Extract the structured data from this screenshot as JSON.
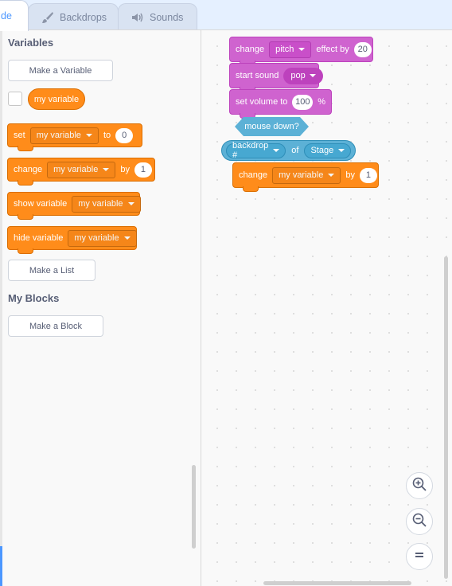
{
  "tabs": [
    {
      "label": "de",
      "icon": "code-icon"
    },
    {
      "label": "Backdrops",
      "icon": "brush-icon"
    },
    {
      "label": "Sounds",
      "icon": "speaker-icon"
    }
  ],
  "palette": {
    "variables_title": "Variables",
    "make_variable": "Make a Variable",
    "variable_reporter": "my variable",
    "set_block": {
      "label": "set",
      "var": "my variable",
      "to": "to",
      "value": "0"
    },
    "change_block": {
      "label": "change",
      "var": "my variable",
      "by": "by",
      "value": "1"
    },
    "show_block": {
      "label": "show variable",
      "var": "my variable"
    },
    "hide_block": {
      "label": "hide variable",
      "var": "my variable"
    },
    "make_list": "Make a List",
    "my_blocks_title": "My Blocks",
    "make_block": "Make a Block"
  },
  "workspace": {
    "effect_block": {
      "label": "change",
      "effect": "pitch",
      "mid": "effect by",
      "value": "20"
    },
    "sound_block": {
      "label": "start sound",
      "sound": "pop"
    },
    "volume_block": {
      "label": "set volume to",
      "value": "100",
      "unit": "%"
    },
    "mouse_down": "mouse down?",
    "sensing_block": {
      "property": "backdrop #",
      "of": "of",
      "target": "Stage"
    },
    "change_block": {
      "label": "change",
      "var": "my variable",
      "by": "by",
      "value": "1"
    }
  },
  "zoom": {
    "zoom_in": "zoom-in-icon",
    "zoom_out": "zoom-out-icon",
    "reset": "zoom-reset-icon"
  },
  "colors": {
    "variables": "#ff8c1a",
    "sound": "#cf63cf",
    "sensing": "#5cb1d6",
    "accent": "#4c97ff"
  }
}
